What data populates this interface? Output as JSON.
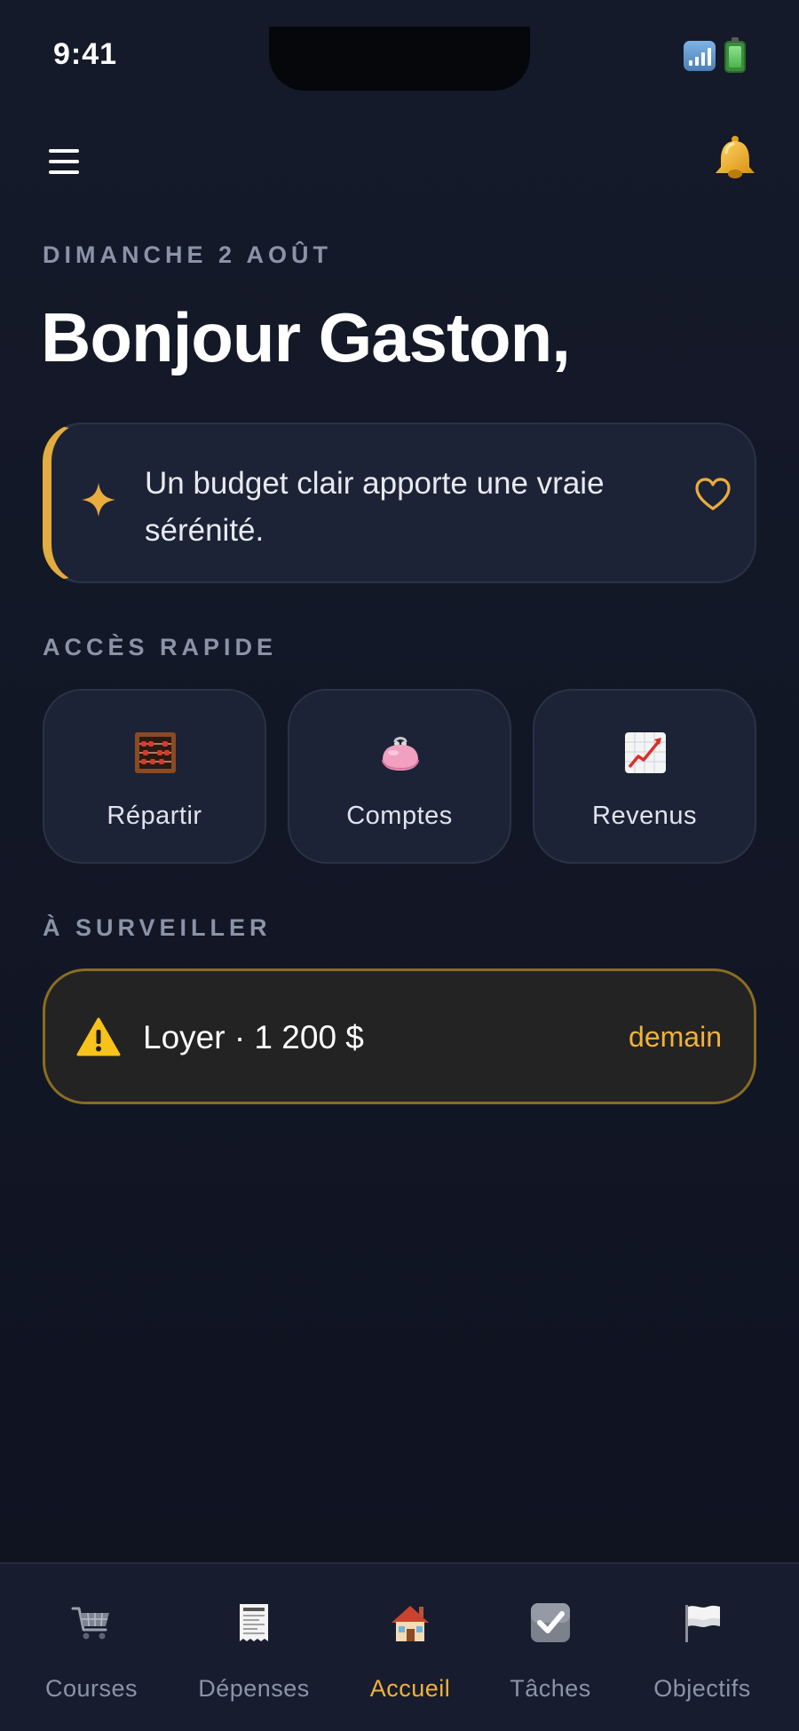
{
  "status_bar": {
    "time": "9:41"
  },
  "header": {
    "date": "DIMANCHE 2 AOÛT",
    "greeting": "Bonjour Gaston,"
  },
  "quote": {
    "text": "Un budget clair apporte une vraie sérénité."
  },
  "quick_access": {
    "title": "ACCÈS RAPIDE",
    "items": [
      {
        "label": "Répartir",
        "icon": "abacus-icon"
      },
      {
        "label": "Comptes",
        "icon": "purse-icon"
      },
      {
        "label": "Revenus",
        "icon": "chart-increasing-icon"
      }
    ]
  },
  "watch": {
    "title": "À SURVEILLER",
    "alert": {
      "text": "Loyer · 1 200 $",
      "when": "demain",
      "icon": "warning-icon"
    }
  },
  "nav": {
    "items": [
      {
        "label": "Courses",
        "icon": "cart-icon",
        "active": false
      },
      {
        "label": "Dépenses",
        "icon": "receipt-icon",
        "active": false
      },
      {
        "label": "Accueil",
        "icon": "house-icon",
        "active": true
      },
      {
        "label": "Tâches",
        "icon": "check-box-icon",
        "active": false
      },
      {
        "label": "Objectifs",
        "icon": "white-flag-icon",
        "active": false
      }
    ]
  },
  "colors": {
    "accent": "#f0b23a",
    "background": "#131829",
    "card": "#1c2336",
    "muted_text": "#8b93a7",
    "alert_border": "#8a6d22"
  }
}
